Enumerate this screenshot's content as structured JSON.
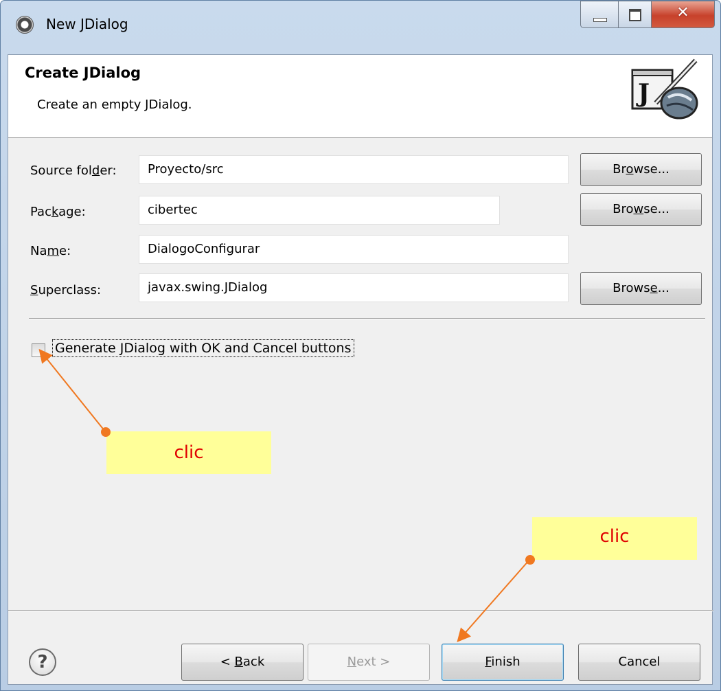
{
  "window": {
    "title": "New JDialog"
  },
  "header": {
    "title": "Create JDialog",
    "subtitle": "Create an empty JDialog."
  },
  "form": {
    "source_folder": {
      "label_pre": "Source fol",
      "label_mnemonic": "d",
      "label_post": "er:",
      "value": "Proyecto/src"
    },
    "package": {
      "label_pre": "Pac",
      "label_mnemonic": "k",
      "label_post": "age:",
      "value": "cibertec"
    },
    "name": {
      "label_pre": "Na",
      "label_mnemonic": "m",
      "label_post": "e:",
      "value": "DialogoConfigurar"
    },
    "superclass": {
      "label_pre": "",
      "label_mnemonic": "S",
      "label_post": "uperclass:",
      "value": "javax.swing.JDialog"
    },
    "browse1": {
      "pre": "Br",
      "mn": "o",
      "post": "wse..."
    },
    "browse2": {
      "pre": "Bro",
      "mn": "w",
      "post": "se..."
    },
    "browse3": {
      "pre": "Brows",
      "mn": "e",
      "post": "..."
    }
  },
  "options": {
    "generate_label": "Generate JDialog with OK and Cancel buttons",
    "generate_checked": false
  },
  "annotations": {
    "callout1": "clic",
    "callout2": "clic",
    "arrow_color": "#f07820"
  },
  "footer": {
    "help_icon": "?",
    "back": {
      "pre": "< ",
      "mn": "B",
      "post": "ack"
    },
    "next": {
      "pre": "",
      "mn": "N",
      "post": "ext >"
    },
    "finish": {
      "pre": "",
      "mn": "F",
      "post": "inish"
    },
    "cancel": "Cancel"
  }
}
